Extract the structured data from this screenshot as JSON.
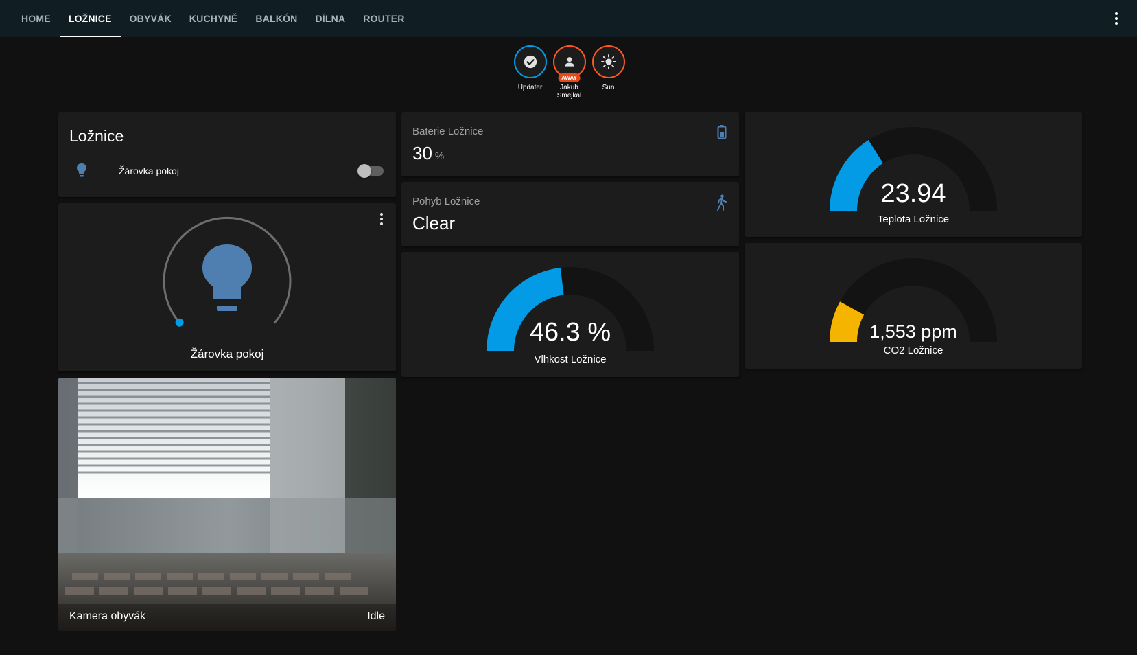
{
  "nav": {
    "tabs": [
      {
        "label": "HOME",
        "active": false
      },
      {
        "label": "LOŽNICE",
        "active": true
      },
      {
        "label": "OBYVÁK",
        "active": false
      },
      {
        "label": "KUCHYNĚ",
        "active": false
      },
      {
        "label": "BALKÓN",
        "active": false
      },
      {
        "label": "DÍLNA",
        "active": false
      },
      {
        "label": "ROUTER",
        "active": false
      }
    ],
    "menu_icon": "more-vertical-icon"
  },
  "badges": [
    {
      "label": "Updater",
      "icon": "check-circle-icon",
      "ring_color": "#039be5"
    },
    {
      "label_line1": "Jakub",
      "label_line2": "Smejkal",
      "icon": "person-icon",
      "state": "AWAY",
      "ring_color": "#ff5722"
    },
    {
      "label": "Sun",
      "icon": "sun-icon",
      "ring_color": "#ff5722"
    }
  ],
  "entities_card": {
    "title": "Ložnice",
    "rows": [
      {
        "name": "Žárovka pokoj",
        "icon": "lightbulb-icon",
        "state": "off"
      }
    ]
  },
  "light_card": {
    "name": "Žárovka pokoj",
    "icon": "lightbulb-icon",
    "color": "#4f7fb0"
  },
  "battery_card": {
    "name": "Baterie Ložnice",
    "value": "30",
    "unit": "%",
    "icon": "battery-icon"
  },
  "motion_card": {
    "name": "Pohyb Ložnice",
    "value": "Clear",
    "icon": "walk-icon"
  },
  "temperature_gauge": {
    "value": "23.94",
    "name": "Teplota Ložnice",
    "fill_fraction": 0.32,
    "color": "#039be5"
  },
  "humidity_gauge": {
    "value": "46.3 %",
    "name": "Vlhkost Ložnice",
    "fill_fraction": 0.463,
    "color": "#039be5"
  },
  "co2_gauge": {
    "value": "1,553 ppm",
    "name": "CO2 Ložnice",
    "fill_fraction": 0.16,
    "color": "#f4b400"
  },
  "camera": {
    "name": "Kamera obyvák",
    "state": "Idle"
  }
}
